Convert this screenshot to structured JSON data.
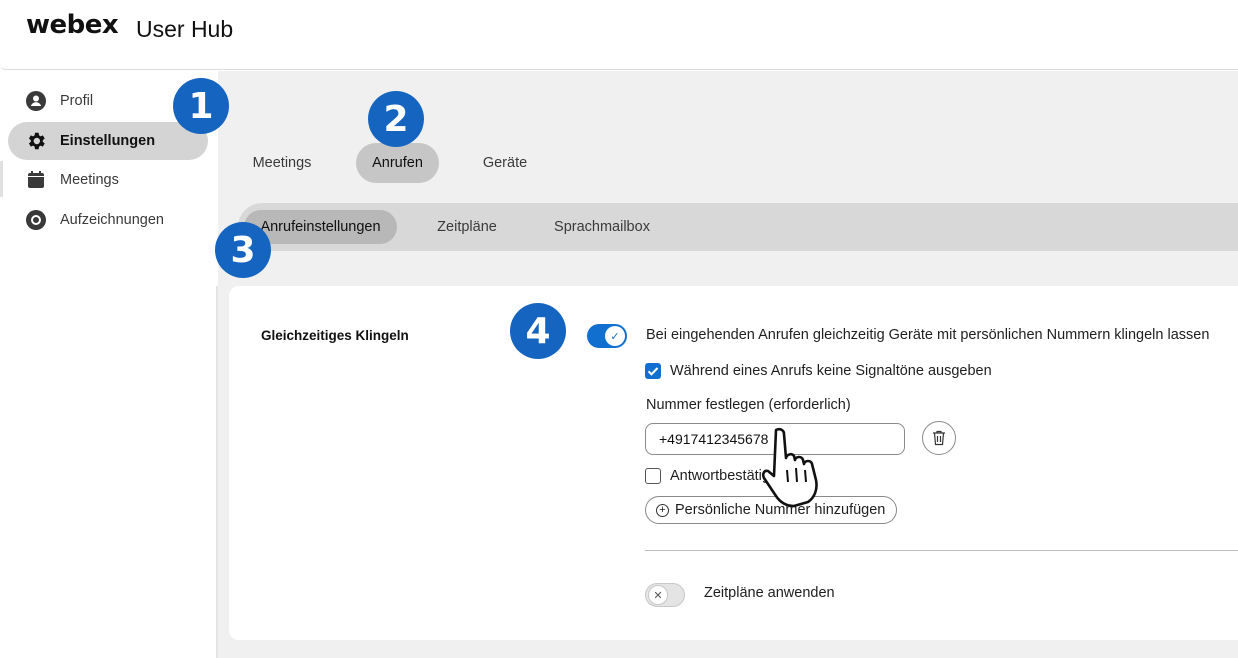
{
  "header": {
    "logo": "webex",
    "app_name": "User Hub"
  },
  "sidebar": {
    "items": [
      {
        "label": "Profil",
        "icon": "profile-icon"
      },
      {
        "label": "Einstellungen",
        "icon": "gear-icon",
        "active": true
      },
      {
        "label": "Meetings",
        "icon": "calendar-icon"
      },
      {
        "label": "Aufzeichnungen",
        "icon": "record-icon"
      }
    ]
  },
  "tabs": [
    {
      "label": "Meetings"
    },
    {
      "label": "Anrufen",
      "active": true
    },
    {
      "label": "Geräte"
    }
  ],
  "subtabs": [
    {
      "label": "Anrufeinstellungen",
      "active": true
    },
    {
      "label": "Zeitpläne"
    },
    {
      "label": "Sprachmailbox"
    }
  ],
  "badges": [
    "1",
    "2",
    "3",
    "4"
  ],
  "simultaneous_ring": {
    "title": "Gleichzeitiges Klingeln",
    "toggle_on": true,
    "toggle_label": "Bei eingehenden Anrufen gleichzeitig Geräte mit persönlichen Nummern klingeln lassen",
    "no_tones_checked": true,
    "no_tones_label": "Während eines Anrufs keine Signaltöne ausgeben",
    "number_label": "Nummer festlegen (erforderlich)",
    "number_value": "+4917412345678",
    "answer_confirm_checked": false,
    "answer_confirm_label": "Antwortbestätig",
    "add_number_label": "Persönliche Nummer hinzufügen",
    "schedules_toggle_on": false,
    "schedules_label": "Zeitpläne anwenden"
  },
  "colors": {
    "accent": "#1170cf",
    "badge": "#1565c0"
  }
}
